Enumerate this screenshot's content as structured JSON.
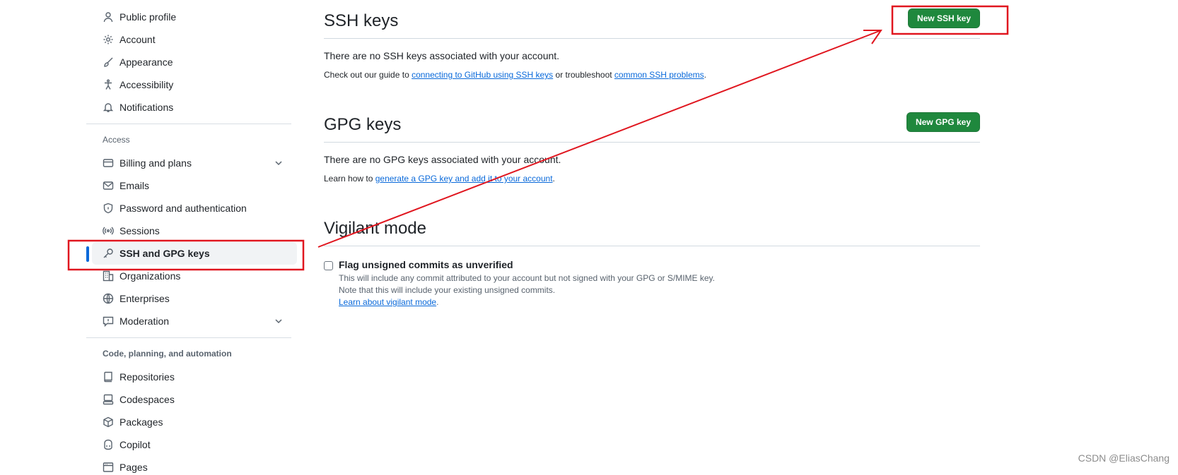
{
  "sidebar": {
    "items_top": [
      {
        "label": "Public profile",
        "icon": "person-icon"
      },
      {
        "label": "Account",
        "icon": "gear-icon"
      },
      {
        "label": "Appearance",
        "icon": "paintbrush-icon"
      },
      {
        "label": "Accessibility",
        "icon": "accessibility-icon"
      },
      {
        "label": "Notifications",
        "icon": "bell-icon"
      }
    ],
    "access_heading": "Access",
    "items_access": [
      {
        "label": "Billing and plans",
        "icon": "credit-card-icon",
        "expandable": true
      },
      {
        "label": "Emails",
        "icon": "mail-icon"
      },
      {
        "label": "Password and authentication",
        "icon": "shield-lock-icon"
      },
      {
        "label": "Sessions",
        "icon": "broadcast-icon"
      },
      {
        "label": "SSH and GPG keys",
        "icon": "key-icon",
        "active": true
      },
      {
        "label": "Organizations",
        "icon": "organization-icon"
      },
      {
        "label": "Enterprises",
        "icon": "globe-icon"
      },
      {
        "label": "Moderation",
        "icon": "report-icon",
        "expandable": true
      }
    ],
    "code_heading": "Code, planning, and automation",
    "items_code": [
      {
        "label": "Repositories",
        "icon": "repo-icon"
      },
      {
        "label": "Codespaces",
        "icon": "codespaces-icon"
      },
      {
        "label": "Packages",
        "icon": "package-icon"
      },
      {
        "label": "Copilot",
        "icon": "copilot-icon"
      },
      {
        "label": "Pages",
        "icon": "browser-icon"
      }
    ]
  },
  "ssh": {
    "title": "SSH keys",
    "button": "New SSH key",
    "empty": "There are no SSH keys associated with your account.",
    "guide_prefix": "Check out our guide to ",
    "guide_link1": "connecting to GitHub using SSH keys",
    "guide_mid": " or troubleshoot ",
    "guide_link2": "common SSH problems",
    "guide_suffix": "."
  },
  "gpg": {
    "title": "GPG keys",
    "button": "New GPG key",
    "empty": "There are no GPG keys associated with your account.",
    "guide_prefix": "Learn how to ",
    "guide_link": "generate a GPG key and add it to your account",
    "guide_suffix": "."
  },
  "vigilant": {
    "title": "Vigilant mode",
    "checkbox_label": "Flag unsigned commits as unverified",
    "checked": false,
    "note1": "This will include any commit attributed to your account but not signed with your GPG or S/MIME key.",
    "note2": "Note that this will include your existing unsigned commits.",
    "learn_link": "Learn about vigilant mode",
    "learn_suffix": "."
  },
  "watermark": "CSDN @EliasChang",
  "colors": {
    "accent_blue": "#0969da",
    "button_green": "#1f883d",
    "annotation_red": "#e0161f"
  }
}
